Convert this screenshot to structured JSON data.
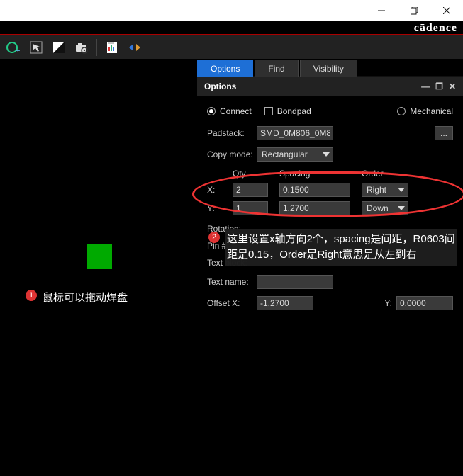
{
  "brand": "cādence",
  "tabs": {
    "options": "Options",
    "find": "Find",
    "visibility": "Visibility"
  },
  "panel_title": "Options",
  "form": {
    "radio_connect": "Connect",
    "radio_bondpad": "Bondpad",
    "radio_mechanical": "Mechanical",
    "padstack_label": "Padstack:",
    "padstack_value": "SMD_0M806_0M8",
    "ellipsis": "...",
    "copy_label": "Copy mode:",
    "copy_value": "Rectangular",
    "hdr_qty": "Qty",
    "hdr_spacing": "Spacing",
    "hdr_order": "Order",
    "x_label": "X:",
    "y_label": "Y:",
    "x_qty": "2",
    "x_spacing": "0.1500",
    "x_order": "Right",
    "y_qty": "1",
    "y_spacing": "1.2700",
    "y_order": "Down",
    "rotation_label": "Rotation:",
    "pin_label": "Pin #:",
    "textblock_label": "Text block:",
    "textname_label": "Text name:",
    "offsetx_label": "Offset X:",
    "offsetx_value": "-1.2700",
    "offsety_label": "Y:",
    "offsety_value": "0.0000"
  },
  "annotations": {
    "a1": "鼠标可以拖动焊盘",
    "a2": "这里设置x轴方向2个，spacing是间距，R0603间距是0.15，Order是Right意思是从左到右"
  }
}
